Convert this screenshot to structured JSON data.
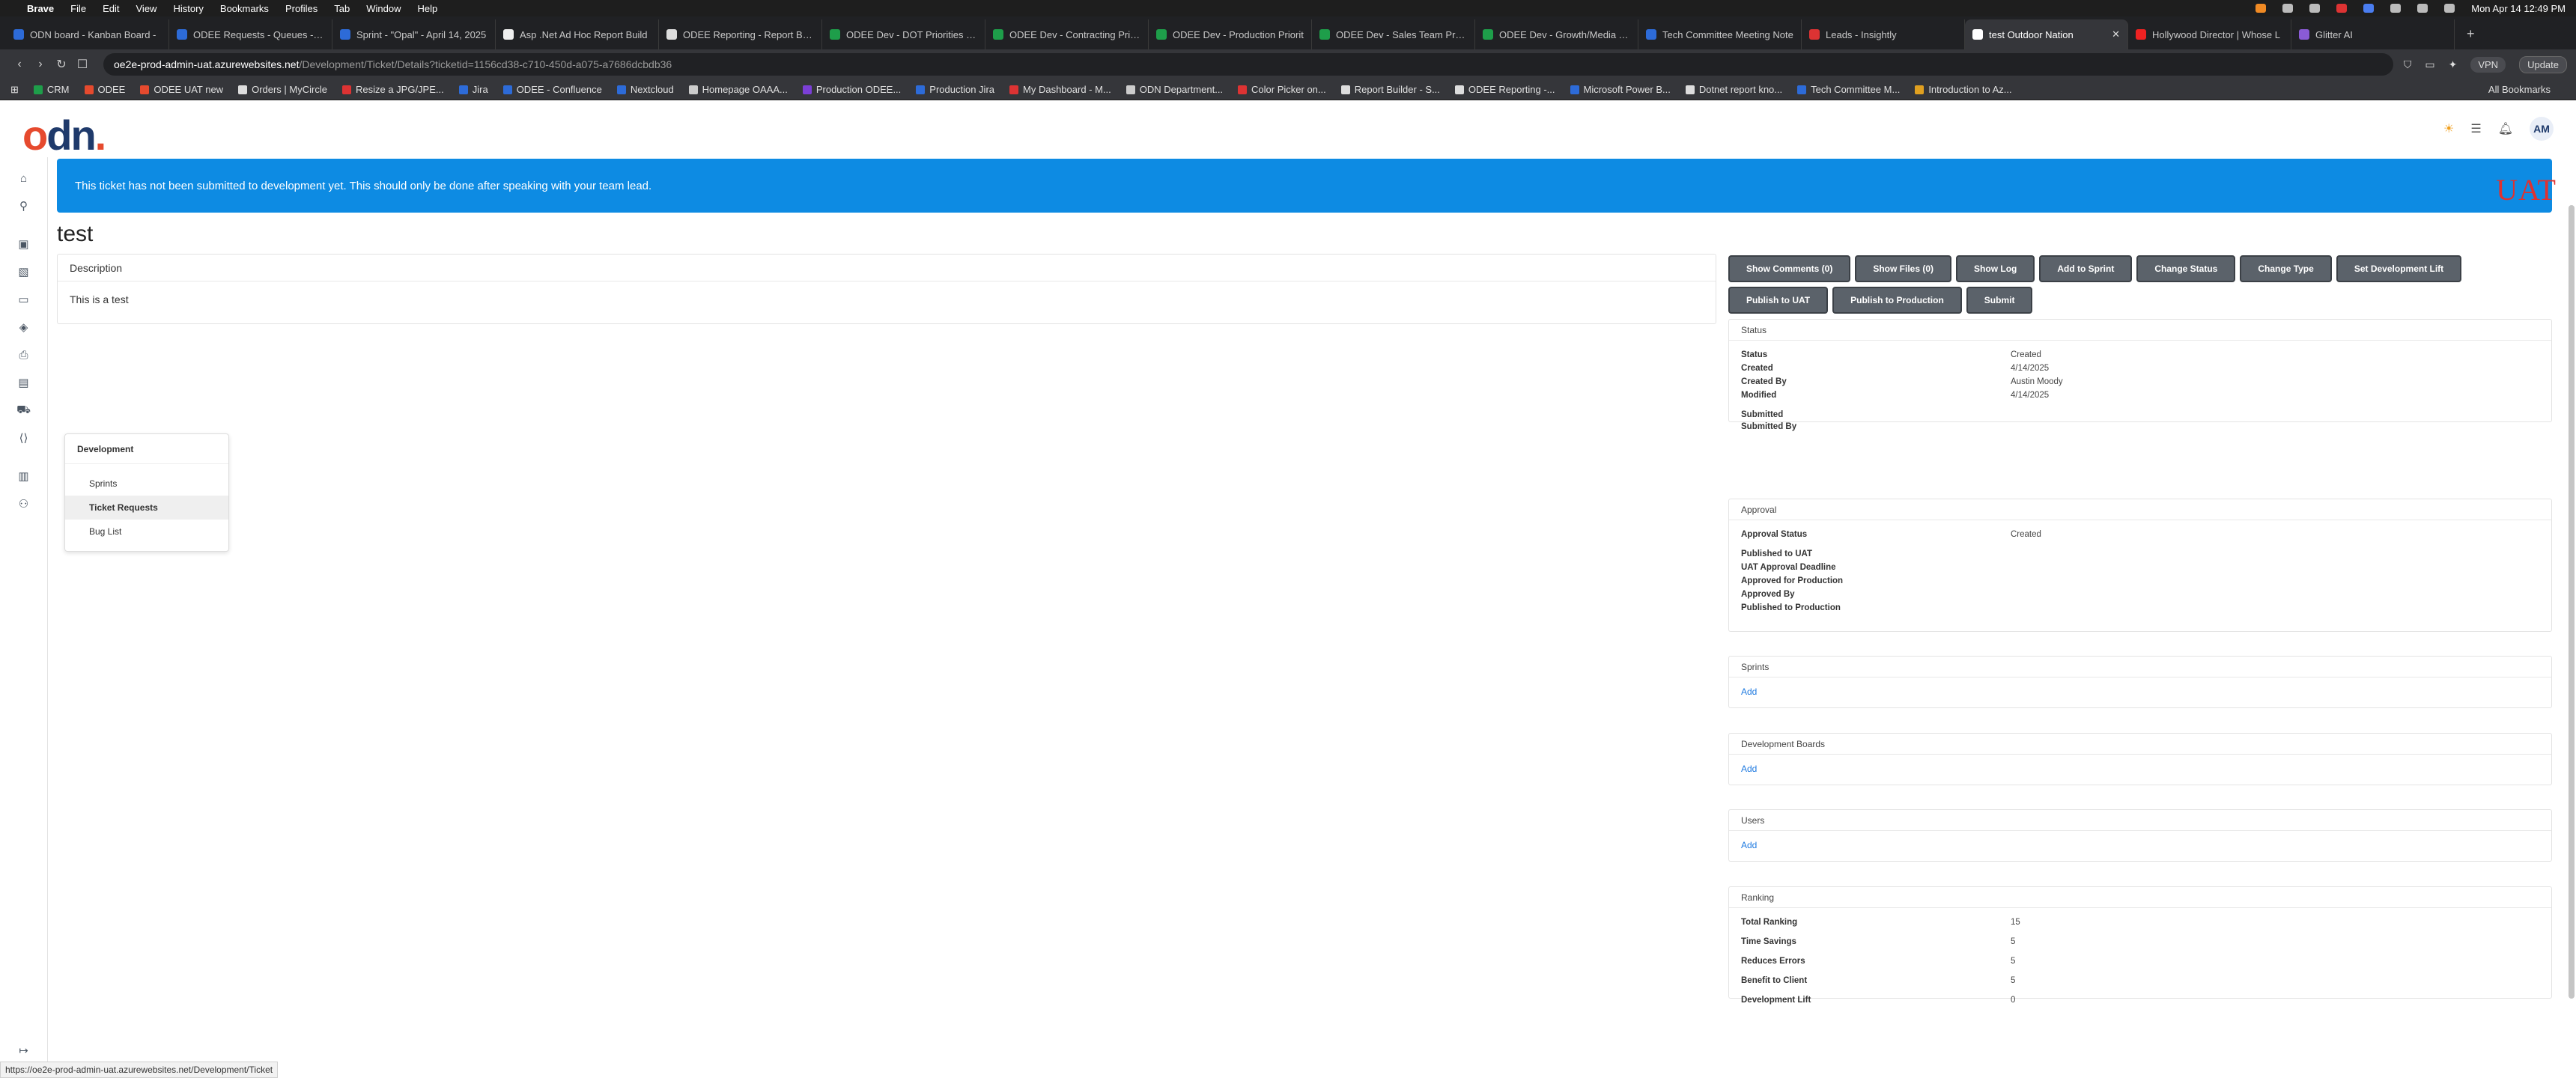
{
  "os_menu": {
    "app_name": "Brave",
    "items": [
      "File",
      "Edit",
      "View",
      "History",
      "Bookmarks",
      "Profiles",
      "Tab",
      "Window",
      "Help"
    ],
    "clock": "Mon Apr 14  12:49 PM"
  },
  "tabs": [
    {
      "title": "ODN board - Kanban Board -",
      "color": "#2d6bd8"
    },
    {
      "title": "ODEE Requests - Queues - All",
      "color": "#2d6bd8"
    },
    {
      "title": "Sprint - \"Opal\" - April 14, 2025",
      "color": "#2d6bd8"
    },
    {
      "title": "Asp .Net Ad Hoc Report Build",
      "color": "#eeeeee"
    },
    {
      "title": "ODEE Reporting - Report Build",
      "color": "#dddddd"
    },
    {
      "title": "ODEE Dev - DOT Priorities Lis",
      "color": "#1e9e4a"
    },
    {
      "title": "ODEE Dev - Contracting Priori",
      "color": "#1e9e4a"
    },
    {
      "title": "ODEE Dev - Production Priorit",
      "color": "#1e9e4a"
    },
    {
      "title": "ODEE Dev - Sales Team Priorit",
      "color": "#1e9e4a"
    },
    {
      "title": "ODEE Dev - Growth/Media Tea",
      "color": "#1e9e4a"
    },
    {
      "title": "Tech Committee Meeting Note",
      "color": "#2d6bd8"
    },
    {
      "title": "Leads - Insightly",
      "color": "#d33"
    },
    {
      "title": "test Outdoor Nation",
      "color": "#ffffff",
      "active": true
    },
    {
      "title": "Hollywood Director | Whose L",
      "color": "#e22"
    },
    {
      "title": "Glitter AI",
      "color": "#8a5bd6"
    }
  ],
  "address": {
    "host": "oe2e-prod-admin-uat.azurewebsites.net",
    "path": "/Development/Ticket/Details?ticketid=1156cd38-c710-450d-a075-a7686dcbdb36",
    "vpn": "VPN",
    "update": "Update"
  },
  "bookmarks": [
    {
      "label": "CRM",
      "color": "#1e9e4a"
    },
    {
      "label": "ODEE",
      "color": "#e64a2e"
    },
    {
      "label": "ODEE UAT new",
      "color": "#e64a2e"
    },
    {
      "label": "Orders | MyCircle",
      "color": "#ddd"
    },
    {
      "label": "Resize a JPG/JPE...",
      "color": "#d33"
    },
    {
      "label": "Jira",
      "color": "#2d6bd8"
    },
    {
      "label": "ODEE - Confluence",
      "color": "#2d6bd8"
    },
    {
      "label": "Nextcloud",
      "color": "#2d6bd8"
    },
    {
      "label": "Homepage OAAA...",
      "color": "#ccc"
    },
    {
      "label": "Production ODEE...",
      "color": "#7b3fd6"
    },
    {
      "label": "Production Jira",
      "color": "#2d6bd8"
    },
    {
      "label": "My Dashboard - M...",
      "color": "#d33"
    },
    {
      "label": "ODN Department...",
      "color": "#ccc"
    },
    {
      "label": "Color Picker on...",
      "color": "#d33"
    },
    {
      "label": "Report Builder - S...",
      "color": "#ddd"
    },
    {
      "label": "ODEE Reporting -...",
      "color": "#ddd"
    },
    {
      "label": "Microsoft Power B...",
      "color": "#2d6bd8"
    },
    {
      "label": "Dotnet report kno...",
      "color": "#ddd"
    },
    {
      "label": "Tech Committee M...",
      "color": "#2d6bd8"
    },
    {
      "label": "Introduction to Az...",
      "color": "#e0a020"
    }
  ],
  "all_bookmarks": "All Bookmarks",
  "logo": {
    "o": "o",
    "d": "d",
    "h": "n",
    "dot": "."
  },
  "header": {
    "avatar_initials": "AM"
  },
  "alert": {
    "text": "This ticket has not been submitted to development yet. This should only be done after speaking with your team lead."
  },
  "env_badge": "UAT",
  "ticket": {
    "title": "test",
    "description_header": "Description",
    "description": "This is a test"
  },
  "actions": [
    "Show Comments (0)",
    "Show Files (0)",
    "Show Log",
    "Add to Sprint",
    "Change Status",
    "Change Type",
    "Set Development Lift",
    "Publish to UAT",
    "Publish to Production",
    "Submit"
  ],
  "status_panel": {
    "title": "Status",
    "rows": [
      {
        "label": "Status",
        "value": "Created"
      },
      {
        "label": "Created",
        "value": "4/14/2025"
      },
      {
        "label": "Created By",
        "value": "Austin Moody"
      },
      {
        "label": "Modified",
        "value": "4/14/2025"
      },
      {
        "label": "Submitted",
        "value": ""
      },
      {
        "label": "Submitted By",
        "value": ""
      }
    ]
  },
  "approval_panel": {
    "title": "Approval",
    "rows": [
      {
        "label": "Approval Status",
        "value": "Created"
      },
      {
        "label": "Published to UAT",
        "value": ""
      },
      {
        "label": "UAT Approval Deadline",
        "value": ""
      },
      {
        "label": "Approved for Production",
        "value": ""
      },
      {
        "label": "Approved By",
        "value": ""
      },
      {
        "label": "Published to Production",
        "value": ""
      }
    ]
  },
  "sprints_panel": {
    "title": "Sprints",
    "add": "Add"
  },
  "boards_panel": {
    "title": "Development Boards",
    "add": "Add"
  },
  "users_panel": {
    "title": "Users",
    "add": "Add"
  },
  "ranking_panel": {
    "title": "Ranking",
    "rows": [
      {
        "label": "Total Ranking",
        "value": "15"
      },
      {
        "label": "Time Savings",
        "value": "5"
      },
      {
        "label": "Reduces Errors",
        "value": "5"
      },
      {
        "label": "Benefit to Client",
        "value": "5"
      },
      {
        "label": "Development Lift",
        "value": "0"
      }
    ]
  },
  "flyout": {
    "title": "Development",
    "items": [
      "Sprints",
      "Ticket Requests",
      "Bug List"
    ],
    "selected_index": 1
  },
  "status_url": "https://oe2e-prod-admin-uat.azurewebsites.net/Development/Ticket"
}
